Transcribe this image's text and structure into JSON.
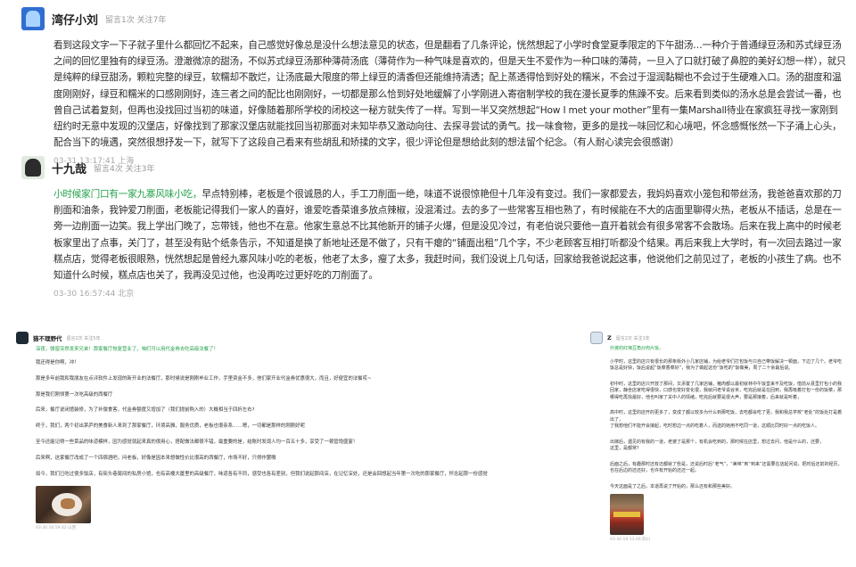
{
  "comments": [
    {
      "username": "湾仔小刘",
      "meta": "留言1次 关注7年",
      "highlight": "",
      "text": "看到这段文字一下子就子里什么都回忆不起来，自己感觉好像总是没什么想法意见的状态，但是翻看了几条评论，恍然想起了小学时食堂夏季限定的下午甜汤…一种介于普通绿豆汤和苏式绿豆汤之间的回忆里独有的绿豆汤。澄澈微凉的甜汤，不似苏式绿豆汤那种薄荷汤底（薄荷作为一种气味是喜欢的，但是天生不爱作为一种口味的薄荷，一旦入了口就打破了鼻腔的美好幻想一样），就只是纯粹的绿豆甜汤，颗粒完整的绿豆，软糯却不散烂，让汤底最大限度的带上绿豆的清香但还能维持清透；配上蒸透得恰到好处的糯米，不会过于湿润黏糊也不会过于生硬难入口。汤的甜度和温度刚刚好，绿豆和糯米的口感刚刚好，连三者之间的配比也刚刚好，一切都是那么恰到好处地缓解了小学刚进入寄宿制学校的我在漫长夏季的焦躁不安。后来看到类似的汤水总是会尝试一番，也曾自己试着复刻，但再也没找回过当初的味道，好像随着那所学校的闭校这一秘方就失传了一样。写到一半又突然想起“How I met your mother”里有一集Marshall待业在家疯狂寻找一家刚到纽约时无意中发现的汉堡店，好像找到了那家汉堡店就能找回当初那面对未知毕恭又激动向往、去探寻尝试的勇气。找一味食物，更多的是找一味回忆和心境吧，怀念感慨怅然一下子涌上心头，配合当下的境遇，突然很想抒发一下，就写下了这段自己看来有些胡乱和矫揉的文字，很少评论但是想给此刻的想法留个纪念。（有人耐心读完会很感谢）",
      "time": "03-31 13:17:41 上海"
    },
    {
      "username": "十九哉",
      "meta": "留言4次 关注3年",
      "highlight": "小时候家门口有一家九寨风味小吃，",
      "text": "早点特别棒，老板是个很诚恳的人，手工刀削面一绝，味道不说很惊艳但十几年没有变过。我们一家都爱去，我妈妈喜欢小笼包和带丝汤，我爸爸喜欢那的刀削面和油条，我钟爱刀削面，老板能记得我们一家人的喜好，谁爱吃香菜谁多放点辣椒，没混淆过。去的多了一些常客互相也熟了，有时候能在不大的店面里聊得火热，老板从不插话，总是在一旁一边削面一边笑。我上学出门晚了，忘带钱，他也不在意。他家生意总不比其他新开的铺子火爆，但是没见冷过，有老伯说只要他一直开着就会有很多常客不会散场。后来在我上高中的时候老板家里出了点事，关门了，甚至没有贴个纸条告示，不知道是换了新地址还是不做了，只有干瘪的“铺面出租”几个字，不少老顾客互相打听都没个结果。再后来我上大学时，有一次回去路过一家糕点店，觉得老板很眼熟，恍然想起是曾经九寨风味小吃的老板，他老了太多，瘦了太多，我赶时间，我们没说上几句话，回家给我爸说起这事，他说他们之前见过了，老板的小孩生了病。也不知道什么时候，糕点店也关了，我再没见过他，也没再吃过更好吃的刀削面了。",
      "time": "03-30 16:57:44 北京"
    },
    {
      "username": "猫不理野代",
      "meta": "留言2次 关注5年",
      "highlight": "深夜，弹窗突然发来兄弟！那家餐厅恢复营业了，咱们可以用代金券去吃高级法餐了！",
      "paragraphs": [
        "我还得是你啊，冲！",
        "那是多年前我和我朋友在点评软件上发现的新开业的法餐厅，那时候说是刚刚毕业工作，手里资金不多，他们家开业代金券优惠很大，而且，好便宜的法餐哎~",
        "那是我们刚领第一次吃高级的西餐厅",
        "后来，餐厅说闭馆装修，为了补偿食客，代金券额度又增加了（我们提前购入的）大概相当于四折左右?",
        "终于，我们，两个初出茅庐的美食新人来到了那家餐厅，环境高雅，服务优质，老板也很亲系……嗯，一切都是那样的刚刚好呢",
        "至今还能记得一些菜品的味道模样，因为感觉就起来真的很用心，搭配做法都很不错，最重要的是，结账时发现人均一百五十多，享受了一顿管饱盛宴！",
        "后来啊，这家餐厅改成了一个四宿酒吧，问老板，好像是因本来想做性价比很高的西餐厅，市场不好，只得作罢嗷",
        "如今，我们已吃过很多饭店，有街头巷尾间的私房小馆，也有高楼大厦里的高级餐厅，味道各有不同，感受也各有差别，但我们说起那间店，在记忆深处，还是会回想起当年第一次吃的那家餐厅，怀念起那一份感觉"
      ],
      "time": "03-30 16:59:42 山西"
    },
    {
      "username": "Z",
      "meta": "留言2次 关注1年",
      "highlight": "外婆的红辣豆角炒肉片饭。",
      "paragraphs": [
        "小学时，这里的店只有很长的那条街外小几家店铺，为给老爷们打包饭与只自己带饭解决一顿面，下边了几个。老爷吃饭总是好快，饭后说起“饭菜香菜好”，我为了做起这份“饭吃的”饭做美，周了二十余最后说。",
        "初中时，这里的店只开放了那间，又添置了几家店铺，猪肉都以最初就林中午饭堂来不及吃饭，借前从县里打包小的我回家，静坐店家吃得很快，口感也变好变化很，我就问老爷说谷米，吃完后就是在回到，我再吸着打包一份的饭菜，那哪得吃再找最好，他也叫家了关中人的情绪，吃完后就要是很大声，要是那接着，后来就是听着，",
        "高中时，这里的店开的更多了，变成了都以较多为什么到那吃饭，去吃都会吃了更，我和我总学校“老处”的饭处打是着出了，",
        "了我想他们不能开会接起，吃时想边一点的吃着人，而送的她用不吃同一道，这顺比同时好一点的吃饭人。",
        "出嫁后，遇见的有我的一道，老婆了是那个，有机会吃到的，那时候在店里，想过去问，他是什么的，还要，",
        "这里，是都常？",
        "后面之后，有趣那时还有还都就了些是，还说后时后“老气”，“美味”到“到来”还需要在店起问说，把时后还前的经历，也在后边的还还好，也许有开始的还还一起。",
        "今天这面是了之后，本道再说了开始的，那么还有和那些美好。"
      ],
      "time": "03-30 19:13:46 四川"
    }
  ]
}
